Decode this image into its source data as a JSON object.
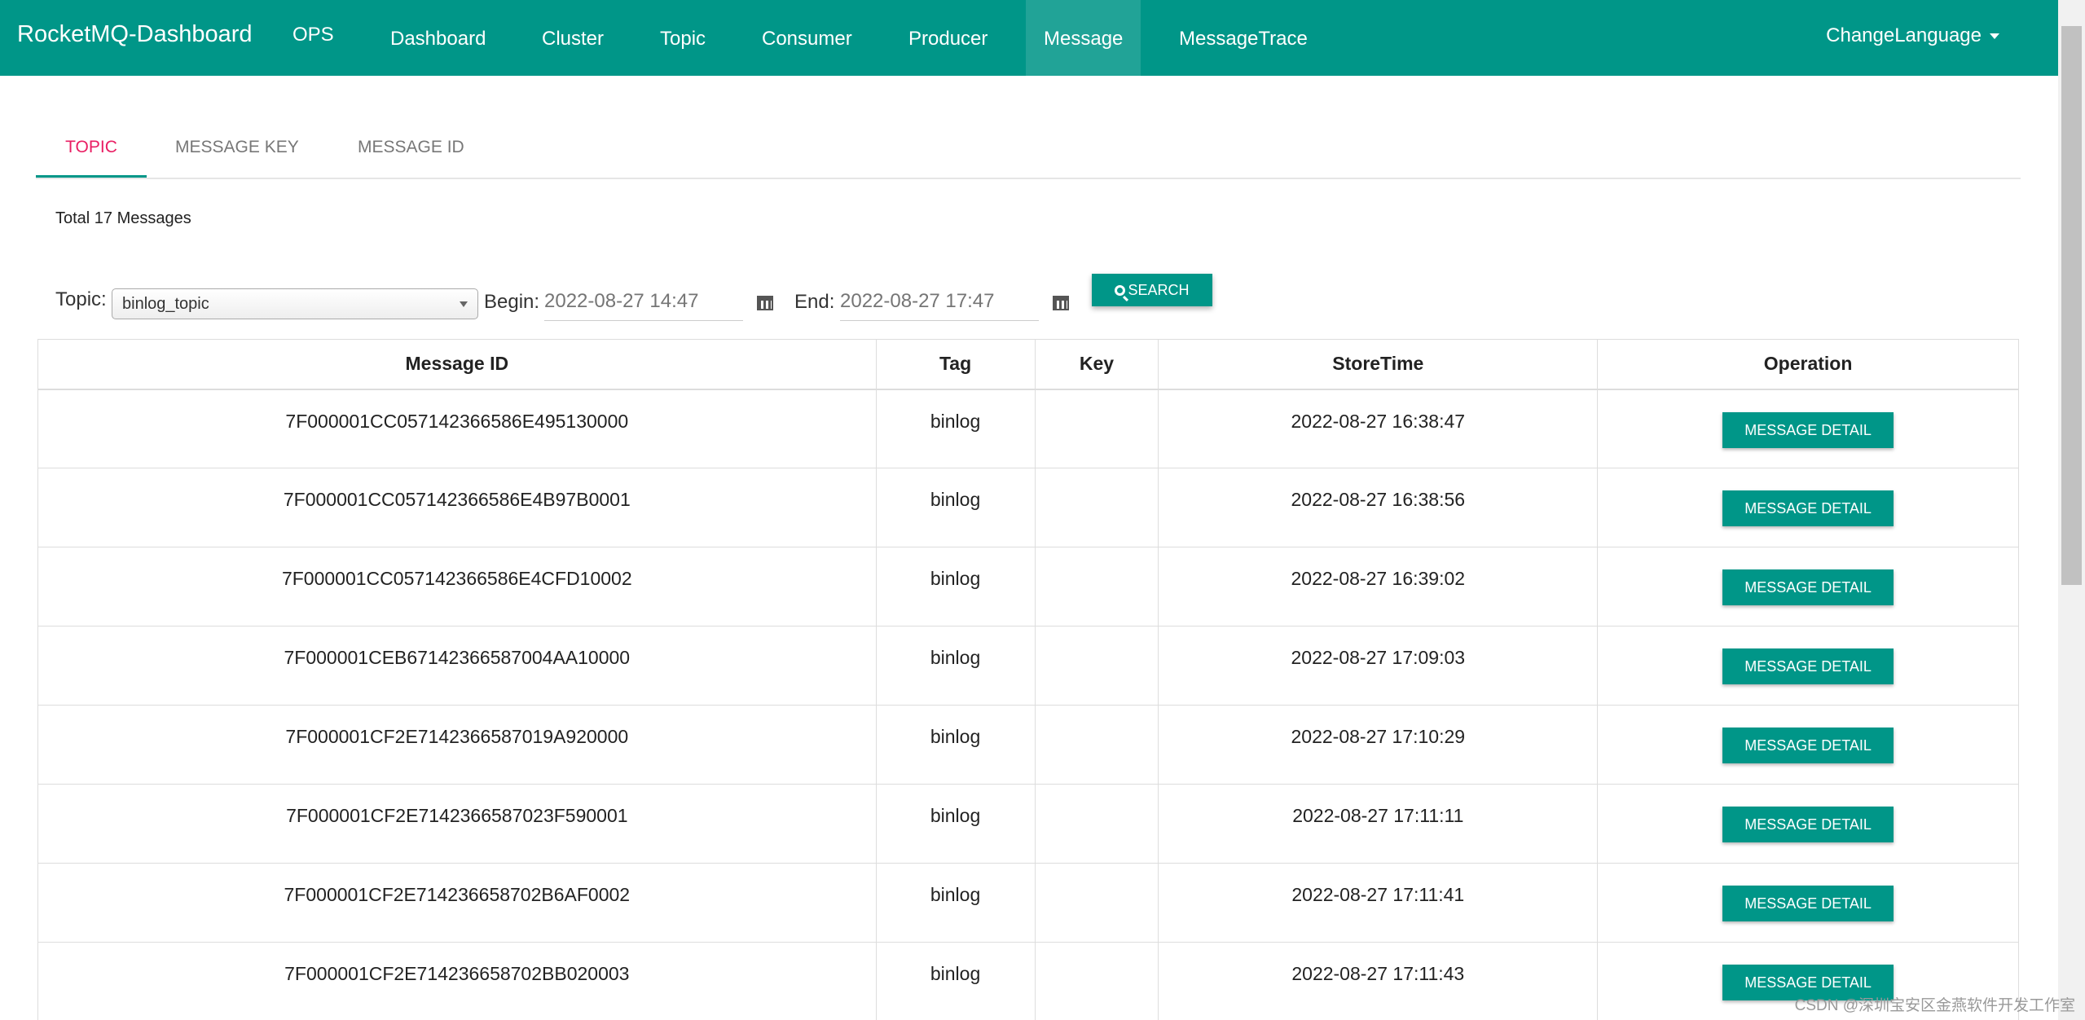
{
  "navbar": {
    "brand": "RocketMQ-Dashboard",
    "items": [
      {
        "label": "OPS"
      },
      {
        "label": "Dashboard"
      },
      {
        "label": "Cluster"
      },
      {
        "label": "Topic"
      },
      {
        "label": "Consumer"
      },
      {
        "label": "Producer"
      },
      {
        "label": "Message"
      },
      {
        "label": "MessageTrace"
      }
    ],
    "active": "Message",
    "language": "ChangeLanguage"
  },
  "tabs": [
    {
      "label": "TOPIC",
      "active": true
    },
    {
      "label": "MESSAGE KEY",
      "active": false
    },
    {
      "label": "MESSAGE ID",
      "active": false
    }
  ],
  "total_text": "Total 17 Messages",
  "search": {
    "topic_label": "Topic:",
    "topic_value": "binlog_topic",
    "begin_label": "Begin:",
    "begin_value": "2022-08-27 14:47",
    "end_label": "End:",
    "end_value": "2022-08-27 17:47",
    "button_label": "SEARCH"
  },
  "table": {
    "headers": [
      "Message ID",
      "Tag",
      "Key",
      "StoreTime",
      "Operation"
    ],
    "button_label": "MESSAGE DETAIL",
    "rows": [
      {
        "id": "7F000001CC057142366586E495130000",
        "tag": "binlog",
        "key": "",
        "time": "2022-08-27 16:38:47"
      },
      {
        "id": "7F000001CC057142366586E4B97B0001",
        "tag": "binlog",
        "key": "",
        "time": "2022-08-27 16:38:56"
      },
      {
        "id": "7F000001CC057142366586E4CFD10002",
        "tag": "binlog",
        "key": "",
        "time": "2022-08-27 16:39:02"
      },
      {
        "id": "7F000001CEB67142366587004AA10000",
        "tag": "binlog",
        "key": "",
        "time": "2022-08-27 17:09:03"
      },
      {
        "id": "7F000001CF2E7142366587019A920000",
        "tag": "binlog",
        "key": "",
        "time": "2022-08-27 17:10:29"
      },
      {
        "id": "7F000001CF2E7142366587023F590001",
        "tag": "binlog",
        "key": "",
        "time": "2022-08-27 17:11:11"
      },
      {
        "id": "7F000001CF2E714236658702B6AF0002",
        "tag": "binlog",
        "key": "",
        "time": "2022-08-27 17:11:41"
      },
      {
        "id": "7F000001CF2E714236658702BB020003",
        "tag": "binlog",
        "key": "",
        "time": "2022-08-27 17:11:43"
      }
    ]
  },
  "watermark": "CSDN @深圳宝安区金燕软件开发工作室",
  "colors": {
    "primary": "#009688",
    "active_tab": "#e91e63"
  }
}
